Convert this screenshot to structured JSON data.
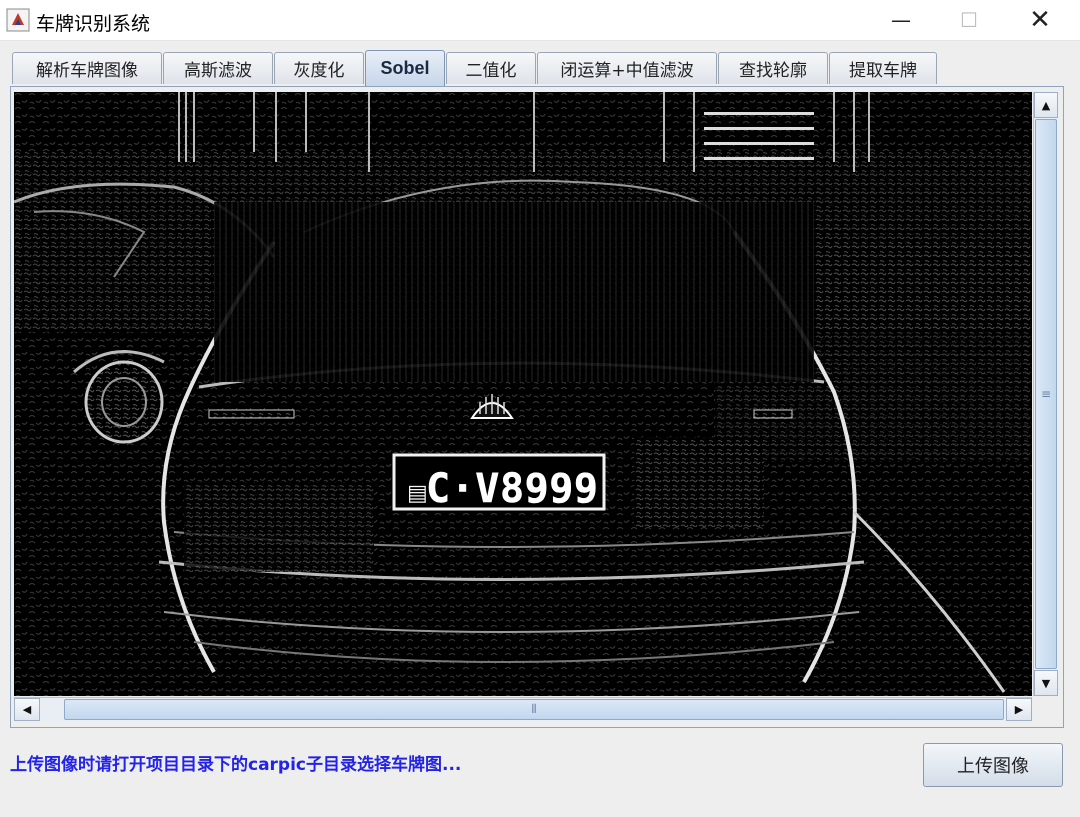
{
  "window": {
    "title": "车牌识别系统",
    "controls": {
      "minimize": "—",
      "maximize": "☐",
      "close": "✕"
    }
  },
  "tabs": [
    {
      "label": "解析车牌图像",
      "selected": false
    },
    {
      "label": "高斯滤波",
      "selected": false
    },
    {
      "label": "灰度化",
      "selected": false
    },
    {
      "label": "Sobel",
      "selected": true
    },
    {
      "label": "二值化",
      "selected": false
    },
    {
      "label": "闭运算+中值滤波",
      "selected": false
    },
    {
      "label": "查找轮廓",
      "selected": false
    },
    {
      "label": "提取车牌",
      "selected": false
    }
  ],
  "image": {
    "plate_text": "C·V8999",
    "plate_prefix_glyph": "▤"
  },
  "scrollbars": {
    "vertical": {
      "up": "▲",
      "down": "▼",
      "grip": "≡"
    },
    "horizontal": {
      "left": "◀",
      "right": "▶",
      "grip": "⦀"
    }
  },
  "footer": {
    "hint": "上传图像时请打开项目目录下的carpic子目录选择车牌图...",
    "upload_button": "上传图像"
  },
  "colors": {
    "hint_text": "#2323e8",
    "selected_tab": "#c7d6ea",
    "image_background": "#000000"
  }
}
